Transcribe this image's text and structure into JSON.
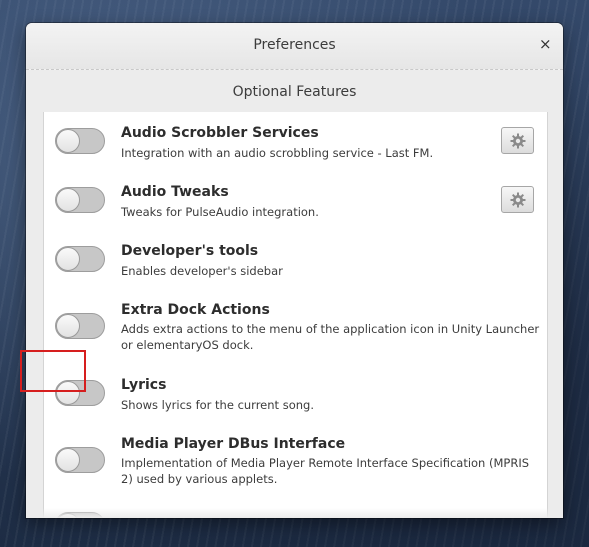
{
  "window": {
    "title": "Preferences",
    "close_label": "×"
  },
  "section": {
    "title": "Optional Features"
  },
  "features": [
    {
      "name": "Audio Scrobbler Services",
      "description": "Integration with an audio scrobbling service - Last FM.",
      "enabled": false,
      "has_settings": true
    },
    {
      "name": "Audio Tweaks",
      "description": "Tweaks for PulseAudio integration.",
      "enabled": false,
      "has_settings": true
    },
    {
      "name": "Developer's tools",
      "description": "Enables developer's sidebar",
      "enabled": false,
      "has_settings": false
    },
    {
      "name": "Extra Dock Actions",
      "description": "Adds extra actions to the menu of the application icon in Unity Launcher or elementaryOS dock.",
      "enabled": false,
      "has_settings": false
    },
    {
      "name": "Lyrics",
      "description": "Shows lyrics for the current song.",
      "enabled": false,
      "has_settings": false
    },
    {
      "name": "Media Player DBus Interface",
      "description": "Implementation of Media Player Remote Interface Specification (MPRIS 2) used by various applets.",
      "enabled": false,
      "has_settings": false
    }
  ],
  "icons": {
    "settings": "gear-icon",
    "close": "close-icon"
  },
  "colors": {
    "highlight": "#d61e1e"
  }
}
